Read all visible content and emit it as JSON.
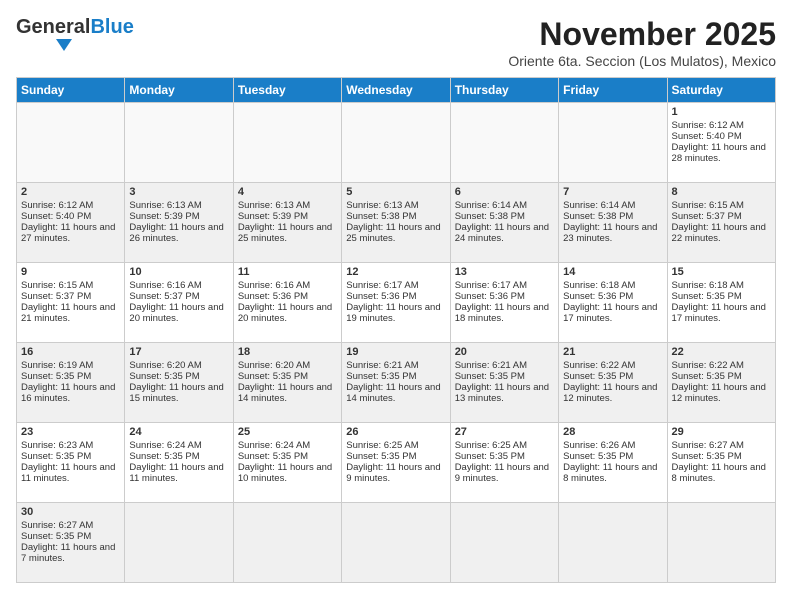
{
  "header": {
    "logo_general": "General",
    "logo_blue": "Blue",
    "title": "November 2025",
    "subtitle": "Oriente 6ta. Seccion (Los Mulatos), Mexico"
  },
  "days_of_week": [
    "Sunday",
    "Monday",
    "Tuesday",
    "Wednesday",
    "Thursday",
    "Friday",
    "Saturday"
  ],
  "weeks": [
    [
      {
        "day": "",
        "empty": true
      },
      {
        "day": "",
        "empty": true
      },
      {
        "day": "",
        "empty": true
      },
      {
        "day": "",
        "empty": true
      },
      {
        "day": "",
        "empty": true
      },
      {
        "day": "",
        "empty": true
      },
      {
        "day": "1",
        "sunrise": "6:12 AM",
        "sunset": "5:40 PM",
        "daylight": "11 hours and 28 minutes."
      }
    ],
    [
      {
        "day": "2",
        "sunrise": "6:12 AM",
        "sunset": "5:40 PM",
        "daylight": "11 hours and 27 minutes."
      },
      {
        "day": "3",
        "sunrise": "6:13 AM",
        "sunset": "5:39 PM",
        "daylight": "11 hours and 26 minutes."
      },
      {
        "day": "4",
        "sunrise": "6:13 AM",
        "sunset": "5:39 PM",
        "daylight": "11 hours and 25 minutes."
      },
      {
        "day": "5",
        "sunrise": "6:13 AM",
        "sunset": "5:38 PM",
        "daylight": "11 hours and 25 minutes."
      },
      {
        "day": "6",
        "sunrise": "6:14 AM",
        "sunset": "5:38 PM",
        "daylight": "11 hours and 24 minutes."
      },
      {
        "day": "7",
        "sunrise": "6:14 AM",
        "sunset": "5:38 PM",
        "daylight": "11 hours and 23 minutes."
      },
      {
        "day": "8",
        "sunrise": "6:15 AM",
        "sunset": "5:37 PM",
        "daylight": "11 hours and 22 minutes."
      }
    ],
    [
      {
        "day": "9",
        "sunrise": "6:15 AM",
        "sunset": "5:37 PM",
        "daylight": "11 hours and 21 minutes."
      },
      {
        "day": "10",
        "sunrise": "6:16 AM",
        "sunset": "5:37 PM",
        "daylight": "11 hours and 20 minutes."
      },
      {
        "day": "11",
        "sunrise": "6:16 AM",
        "sunset": "5:36 PM",
        "daylight": "11 hours and 20 minutes."
      },
      {
        "day": "12",
        "sunrise": "6:17 AM",
        "sunset": "5:36 PM",
        "daylight": "11 hours and 19 minutes."
      },
      {
        "day": "13",
        "sunrise": "6:17 AM",
        "sunset": "5:36 PM",
        "daylight": "11 hours and 18 minutes."
      },
      {
        "day": "14",
        "sunrise": "6:18 AM",
        "sunset": "5:36 PM",
        "daylight": "11 hours and 17 minutes."
      },
      {
        "day": "15",
        "sunrise": "6:18 AM",
        "sunset": "5:35 PM",
        "daylight": "11 hours and 17 minutes."
      }
    ],
    [
      {
        "day": "16",
        "sunrise": "6:19 AM",
        "sunset": "5:35 PM",
        "daylight": "11 hours and 16 minutes."
      },
      {
        "day": "17",
        "sunrise": "6:20 AM",
        "sunset": "5:35 PM",
        "daylight": "11 hours and 15 minutes."
      },
      {
        "day": "18",
        "sunrise": "6:20 AM",
        "sunset": "5:35 PM",
        "daylight": "11 hours and 14 minutes."
      },
      {
        "day": "19",
        "sunrise": "6:21 AM",
        "sunset": "5:35 PM",
        "daylight": "11 hours and 14 minutes."
      },
      {
        "day": "20",
        "sunrise": "6:21 AM",
        "sunset": "5:35 PM",
        "daylight": "11 hours and 13 minutes."
      },
      {
        "day": "21",
        "sunrise": "6:22 AM",
        "sunset": "5:35 PM",
        "daylight": "11 hours and 12 minutes."
      },
      {
        "day": "22",
        "sunrise": "6:22 AM",
        "sunset": "5:35 PM",
        "daylight": "11 hours and 12 minutes."
      }
    ],
    [
      {
        "day": "23",
        "sunrise": "6:23 AM",
        "sunset": "5:35 PM",
        "daylight": "11 hours and 11 minutes."
      },
      {
        "day": "24",
        "sunrise": "6:24 AM",
        "sunset": "5:35 PM",
        "daylight": "11 hours and 11 minutes."
      },
      {
        "day": "25",
        "sunrise": "6:24 AM",
        "sunset": "5:35 PM",
        "daylight": "11 hours and 10 minutes."
      },
      {
        "day": "26",
        "sunrise": "6:25 AM",
        "sunset": "5:35 PM",
        "daylight": "11 hours and 9 minutes."
      },
      {
        "day": "27",
        "sunrise": "6:25 AM",
        "sunset": "5:35 PM",
        "daylight": "11 hours and 9 minutes."
      },
      {
        "day": "28",
        "sunrise": "6:26 AM",
        "sunset": "5:35 PM",
        "daylight": "11 hours and 8 minutes."
      },
      {
        "day": "29",
        "sunrise": "6:27 AM",
        "sunset": "5:35 PM",
        "daylight": "11 hours and 8 minutes."
      }
    ],
    [
      {
        "day": "30",
        "sunrise": "6:27 AM",
        "sunset": "5:35 PM",
        "daylight": "11 hours and 7 minutes."
      },
      {
        "day": "",
        "empty": true
      },
      {
        "day": "",
        "empty": true
      },
      {
        "day": "",
        "empty": true
      },
      {
        "day": "",
        "empty": true
      },
      {
        "day": "",
        "empty": true
      },
      {
        "day": "",
        "empty": true
      }
    ]
  ]
}
